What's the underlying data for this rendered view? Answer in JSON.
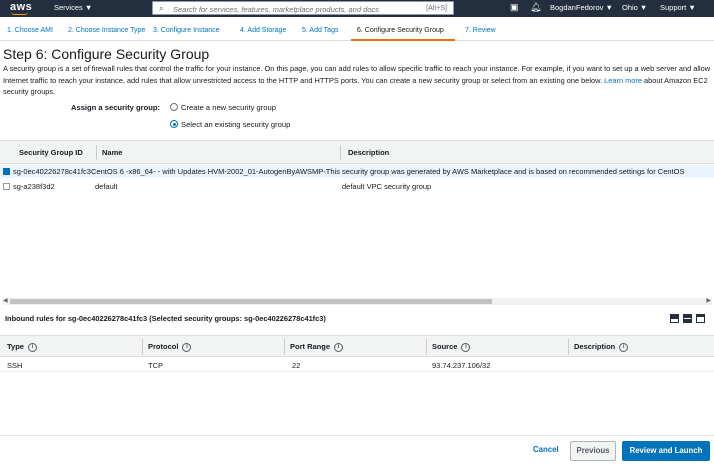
{
  "topnav": {
    "logo": "aws",
    "services": "Services ▼",
    "search_placeholder": "Search for services, features, marketplace products, and docs",
    "search_shortcut": "[Alt+S]",
    "user": "BogdanFedorov ▼",
    "region": "Ohio ▼",
    "support": "Support ▼"
  },
  "tabs": [
    "1. Choose AMI",
    "2. Choose Instance Type",
    "3. Configure Instance",
    "4. Add Storage",
    "5. Add Tags",
    "6. Configure Security Group",
    "7. Review"
  ],
  "page": {
    "title": "Step 6: Configure Security Group",
    "desc1": "A security group is a set of firewall rules that control the traffic for your instance. On this page, you can add rules to allow specific traffic to reach your instance. For example, if you want to set up a web server and allow Internet traffic to reach your instance, add rules that allow unrestricted access to the HTTP and HTTPS ports. You can create a new security group or select from an existing one below.",
    "learn_more": "Learn more",
    "desc2": " about Amazon EC2 security groups."
  },
  "assign": {
    "label": "Assign a security group:",
    "create_new": "Create a new security group",
    "select_existing": "Select an existing security group"
  },
  "sg_table": {
    "headers": [
      "Security Group ID",
      "Name",
      "Description"
    ],
    "rows": [
      {
        "text": "sg-0ec40226278c41fc3CentOS 6 -x86_64- - with Updates HVM-2002_01-AutogenByAWSMP-This security group was generated by AWS Marketplace and is based on recommended settings for CentOS"
      },
      {
        "id": "sg-a238f3d2",
        "name": "default",
        "description": "default VPC security group"
      }
    ]
  },
  "inbound": {
    "title": "Inbound rules for sg-0ec40226278c41fc3 (Selected security groups: sg-0ec40226278c41fc3)",
    "headers": [
      "Type",
      "Protocol",
      "Port Range",
      "Source",
      "Description"
    ],
    "rows": [
      {
        "type": "SSH",
        "protocol": "TCP",
        "port": "22",
        "source": "93.74.237.106/32",
        "description": ""
      }
    ]
  },
  "footer": {
    "cancel": "Cancel",
    "previous": "Previous",
    "launch": "Review and Launch"
  }
}
